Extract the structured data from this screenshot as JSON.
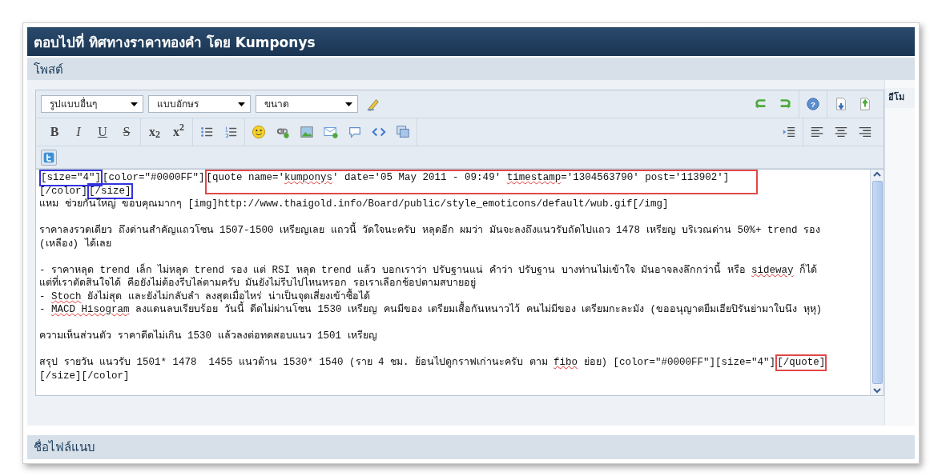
{
  "header": {
    "title": "ตอบไปที่ ทิศทางราคาทองคำ โดย Kumponys"
  },
  "post_section": {
    "label": "โพสต์"
  },
  "side_panel": {
    "label": "อีโม"
  },
  "toolbar": {
    "dropdowns": [
      {
        "label": "รูปแบบอื่นๆ"
      },
      {
        "label": "แบบอักษร"
      },
      {
        "label": "ขนาด"
      }
    ],
    "row1_tools": [
      {
        "kind": "clear-format"
      }
    ],
    "row1_right": [
      [
        {
          "kind": "undo"
        },
        {
          "kind": "redo"
        }
      ],
      [
        {
          "kind": "help",
          "label": "?"
        }
      ],
      [
        {
          "kind": "download"
        },
        {
          "kind": "upload"
        }
      ]
    ],
    "row2_left": [
      [
        {
          "kind": "bold",
          "label": "B"
        },
        {
          "kind": "italic",
          "label": "I"
        },
        {
          "kind": "underline",
          "label": "U"
        },
        {
          "kind": "strike",
          "label": "S"
        }
      ],
      [
        {
          "kind": "subscript",
          "label": "x$_{2}$"
        },
        {
          "kind": "superscript",
          "label": "x$^{2}$"
        }
      ],
      [
        {
          "kind": "bullet-list"
        },
        {
          "kind": "number-list"
        }
      ],
      [
        {
          "kind": "smiley"
        },
        {
          "kind": "link"
        },
        {
          "kind": "image"
        },
        {
          "kind": "email"
        },
        {
          "kind": "speech"
        },
        {
          "kind": "code"
        },
        {
          "kind": "media"
        }
      ]
    ],
    "row2_right": [
      [
        {
          "kind": "indent"
        }
      ],
      [
        {
          "kind": "align-left"
        },
        {
          "kind": "align-center"
        },
        {
          "kind": "align-right"
        }
      ]
    ],
    "row3": [
      {
        "kind": "twitter"
      }
    ]
  },
  "editor": {
    "lines": [
      {
        "kind": "text",
        "segments": [
          {
            "text": "[size=\"4\"]",
            "color": "#3333dd"
          },
          {
            "text": "[color=\"#0000FF\"]"
          },
          {
            "color": "#e04848",
            "parts": [
              {
                "text": "[quote name='"
              },
              {
                "text": "kumponys",
                "misspelled": true
              },
              {
                "text": "' date='05 May 2011 - 09:49' "
              },
              {
                "text": "timestamp",
                "misspelled": true
              },
              {
                "text": "='1304563790' post='113902']"
              }
            ]
          }
        ]
      },
      {
        "kind": "text",
        "segments": [
          {
            "text": "[/color]"
          },
          {
            "text": "[/size]",
            "color": "#3333dd"
          }
        ]
      },
      {
        "kind": "text",
        "segments": [
          {
            "text": "แหม ช่วยกันใหญ่ ขอบคุณมากๆ [img]http://www.thaigold.info/Board/public/style_emoticons/default/wub.gif[/img]"
          }
        ]
      },
      {
        "kind": "blank"
      },
      {
        "kind": "text",
        "segments": [
          {
            "text": "ราคาลงรวดเดียว ถึงด่านสำคัญแถวโซน 1507-1500 เหรียญเลย แถวนี้ วัดใจนะครับ หลุดอีก ผมว่า มันจะลงถึงแนวรับถัดไปแถว 1478 เหรียญ บริเวณด่าน 50%+ trend รอง"
          }
        ]
      },
      {
        "kind": "text",
        "segments": [
          {
            "text": "(เหลือง) ได้เลย"
          }
        ]
      },
      {
        "kind": "blank"
      },
      {
        "kind": "text",
        "segments": [
          {
            "text": "- ราคาหลุด trend เล็ก ไม่หลุด trend รอง แต่ RSI หลุด trend แล้ว บอกเราว่า ปรับฐานแน่ คำว่า ปรับฐาน บางท่านไม่เข้าใจ มันอาจลงลึกกว่านี้ หรือ "
          },
          {
            "text": "sideway",
            "misspelled": true
          },
          {
            "text": " ก็ได้"
          }
        ]
      },
      {
        "kind": "text",
        "segments": [
          {
            "text": "แต่ที่เราตัดสินใจได้ คือยังไม่ต้องรีบไล่ตามครับ มันยังไม่รีบไปไหนหรอก รอเราเลือกช้อปตามสบายอยู่"
          }
        ]
      },
      {
        "kind": "text",
        "segments": [
          {
            "text": "- "
          },
          {
            "text": "Stoch",
            "misspelled": true
          },
          {
            "text": " ยังไม่สุด และยังไม่กลับลำ ลงสุดเมื่อไหร่ น่าเป็นจุดเสี่ยงเข้าซื้อได้"
          }
        ]
      },
      {
        "kind": "text",
        "segments": [
          {
            "text": "- "
          },
          {
            "text": "MACD Hisogram",
            "misspelled": true
          },
          {
            "text": " ลงแดนลบเรียบร้อย วันนี้ ดีดไม่ผ่านโซน 1530 เหรียญ คนมีของ เตรียมเสื้อกันหนาวไว้ คนไม่มีของ เตรียมกะละมัง (ขออนุญาตยืมเฮียปิรันย่ามาใบนึง หุหุ)"
          }
        ]
      },
      {
        "kind": "blank"
      },
      {
        "kind": "text",
        "segments": [
          {
            "text": "ความเห็นส่วนตัว ราคาดีดไม่เกิน 1530 แล้วลงต่อทดสอบแนว 1501 เหรียญ"
          }
        ]
      },
      {
        "kind": "blank"
      },
      {
        "kind": "text",
        "segments": [
          {
            "text": "สรุป รายวัน แนวรับ 1501* 1478  1455 แนวต้าน 1530* 1540 (ราย 4 ชม. ย้อนไปดูกราฟเก่านะครับ ตาม "
          },
          {
            "text": "fibo",
            "misspelled": true
          },
          {
            "text": " ย่อย) [color=\"#0000FF\"][size=\"4\"]"
          },
          {
            "text": "[/quote]",
            "color": "#e04848"
          }
        ]
      },
      {
        "kind": "text",
        "segments": [
          {
            "text": "[/size][/color]"
          }
        ]
      }
    ]
  },
  "attachments": {
    "label": "ชื่อไฟล์แนบ"
  }
}
